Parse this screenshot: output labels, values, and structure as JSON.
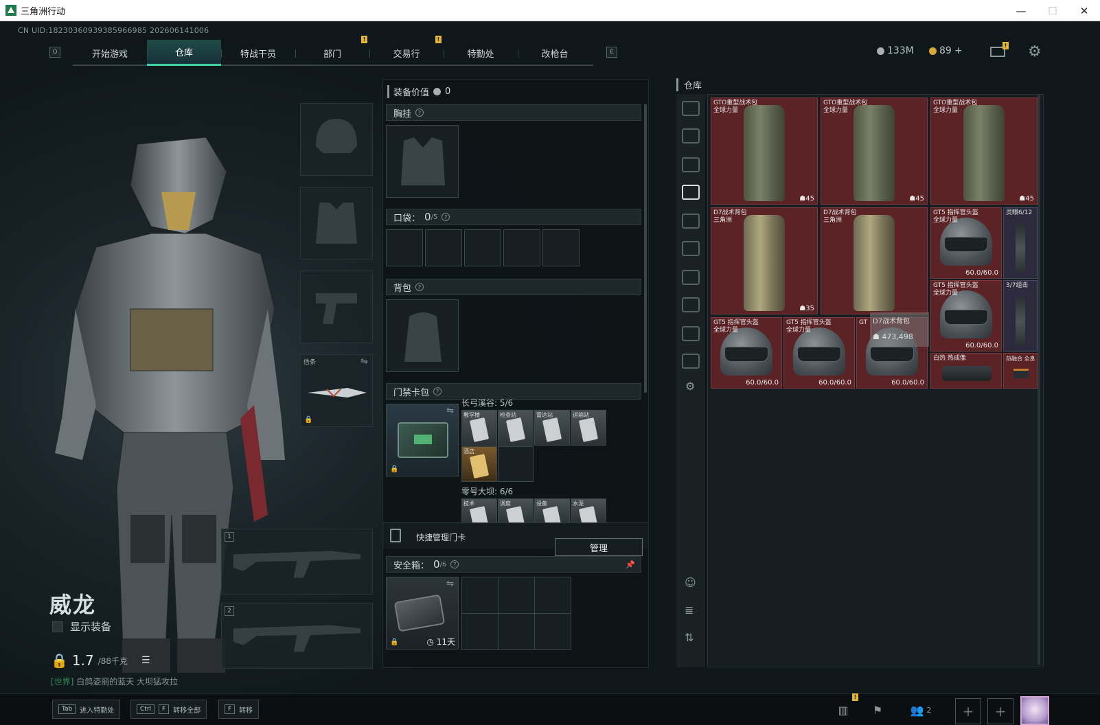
{
  "window": {
    "title": "三角洲行动"
  },
  "header": {
    "uid": "CN UID:18230360939385966985 202606141006",
    "nav_left_key": "Q",
    "nav_right_key": "E",
    "tabs": [
      {
        "label": "开始游戏"
      },
      {
        "label": "仓库",
        "active": true
      },
      {
        "label": "特战干员"
      },
      {
        "label": "部门"
      },
      {
        "label": "交易行"
      },
      {
        "label": "特勤处"
      },
      {
        "label": "改枪台"
      }
    ],
    "currency_silver": "133M",
    "currency_gold": "89",
    "currency_gold_plus": "+",
    "badge_mark": "!"
  },
  "character": {
    "name": "威龙",
    "show_equipment_label": "显示装备",
    "weight": "1.7",
    "weight_max": "/88千克",
    "world_prefix": "[世界]",
    "world_message": "白鸽姿丽的蓝天 大坝猛攻拉"
  },
  "slots": {
    "melee_label": "信条",
    "weapon1_num": "1",
    "weapon2_num": "2"
  },
  "loadout": {
    "equip_value_label": "装备价值",
    "equip_value": "0",
    "chest_label": "胸挂",
    "pocket_label": "口袋：",
    "pocket_count": "0",
    "pocket_max": "/5",
    "backpack_label": "背包",
    "keycard_label": "门禁卡包",
    "map1_name": "长弓溪谷: 5/6",
    "map1_cards": [
      "教学楼",
      "检查站",
      "雷达站",
      "运输站",
      "酒店"
    ],
    "map2_name": "零号大坝: 6/6",
    "map2_cards": [
      "技术",
      "调度",
      "设备",
      "水泥"
    ],
    "quick_manage_label": "快捷管理门卡",
    "manage_button": "管理",
    "safebox_label": "安全箱：",
    "safebox_count": "0",
    "safebox_max": "/6",
    "safebox_days": "11天"
  },
  "stash": {
    "title": "仓库",
    "items": [
      {
        "name": "GTO重型战术包\n全球力量",
        "value": "45"
      },
      {
        "name": "GTO重型战术包\n全球力量",
        "value": "45"
      },
      {
        "name": "GTO重型战术包\n全球力量",
        "value": "45"
      },
      {
        "name": "D7战术背包\n三角洲",
        "value": "35"
      },
      {
        "name": "D7战术背包\n三角洲",
        "value": ""
      },
      {
        "name": "GT5 指挥官头盔\n全球力量",
        "value": "60.0/60.0"
      },
      {
        "name": "灵眼6/12",
        "value": ""
      },
      {
        "name": "GT5 指挥官头盔\n全球力量",
        "value": "60.0/60.0"
      },
      {
        "name": "3/7组击",
        "value": ""
      },
      {
        "name": "GT5 指挥官头盔\n全球力量",
        "value": "60.0/60.0"
      },
      {
        "name": "GT5 指挥官头盔\n全球力量",
        "value": "60.0/60.0"
      },
      {
        "name": "GT",
        "value": "60.0/60.0"
      },
      {
        "name": "白热 热成像",
        "value": ""
      },
      {
        "name": "热融合 全息",
        "value": ""
      }
    ],
    "tooltip_name": "D7战术背包",
    "tooltip_value": "473,498"
  },
  "bottom": {
    "hotkeys": [
      {
        "keys": [
          "Tab"
        ],
        "label": "进入特勤处"
      },
      {
        "keys": [
          "Ctrl",
          "F"
        ],
        "label": "转移全部"
      },
      {
        "keys": [
          "F"
        ],
        "label": "转移"
      }
    ],
    "squad_count": "2"
  },
  "colors": {
    "accent": "#3fd1a0",
    "item_bg": "#5c2327",
    "badge": "#e2b532"
  }
}
